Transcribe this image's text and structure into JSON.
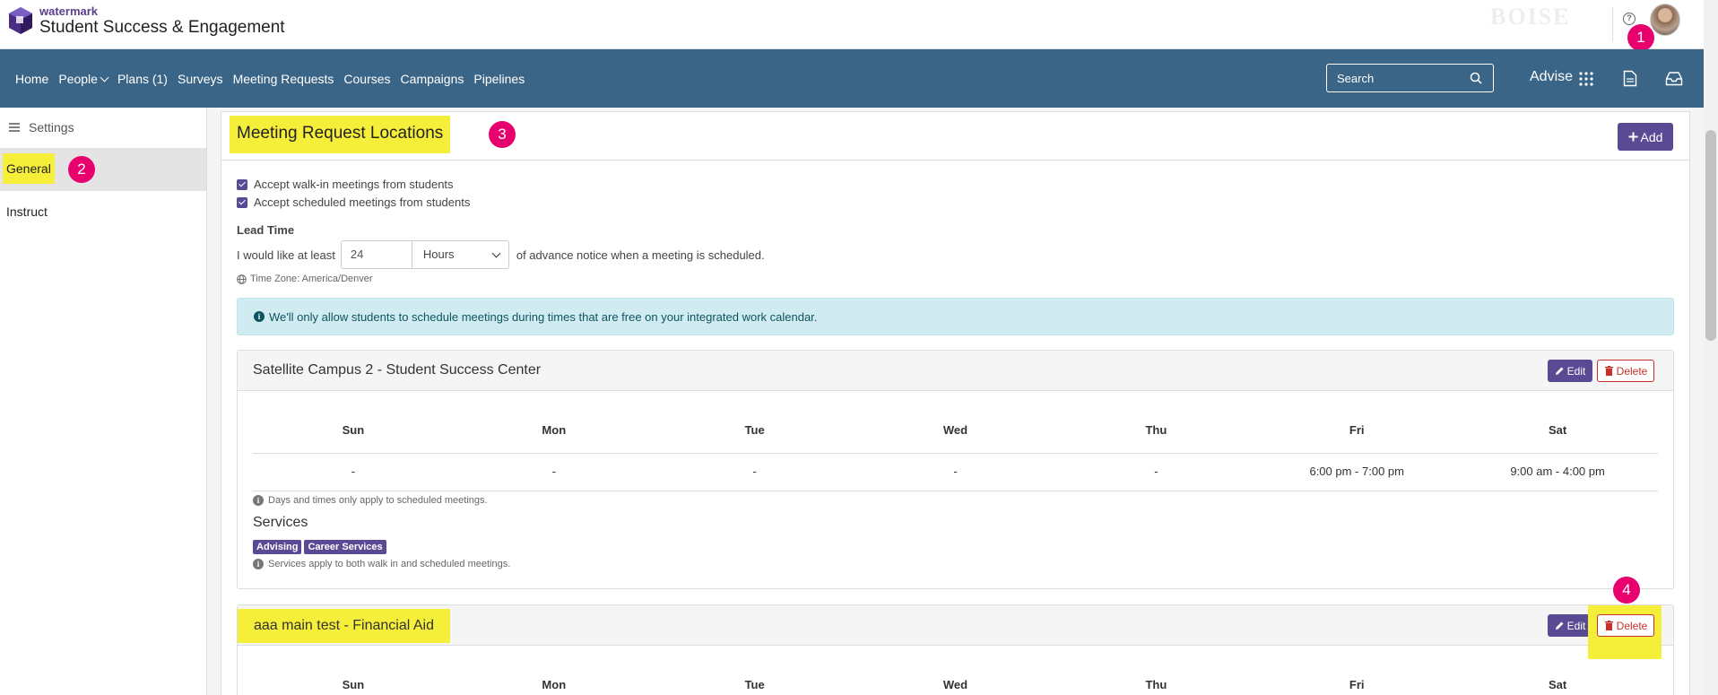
{
  "app": {
    "logo_small": "watermark",
    "logo_title": "Student Success & Engagement",
    "seal_text": "BOISE"
  },
  "callouts": [
    "1",
    "2",
    "3",
    "4"
  ],
  "nav": {
    "items": [
      "Home",
      "People",
      "Plans (1)",
      "Surveys",
      "Meeting Requests",
      "Courses",
      "Campaigns",
      "Pipelines"
    ],
    "search_placeholder": "Search",
    "advise_label": "Advise"
  },
  "sidebar": {
    "header": "Settings",
    "items": [
      "General",
      "Instruct"
    ]
  },
  "page": {
    "title": "Meeting Request Locations",
    "add_label": "Add",
    "check_walkin": "Accept walk-in meetings from students",
    "check_scheduled": "Accept scheduled meetings from students",
    "lead_time_label": "Lead Time",
    "lead_prefix": "I would like at least",
    "lead_value": "24",
    "lead_unit": "Hours",
    "lead_suffix": "of advance notice when a meeting is scheduled.",
    "timezone": "Time Zone: America/Denver",
    "alert": "We'll only allow students to schedule meetings during times that are free on your integrated work calendar."
  },
  "days": [
    "Sun",
    "Mon",
    "Tue",
    "Wed",
    "Thu",
    "Fri",
    "Sat"
  ],
  "locations": [
    {
      "name": "Satellite Campus 2 - Student Success Center",
      "edit_label": "Edit",
      "delete_label": "Delete",
      "hours": [
        "-",
        "-",
        "-",
        "-",
        "-",
        "6:00 pm - 7:00 pm",
        "9:00 am - 4:00 pm"
      ],
      "days_note": "Days and times only apply to scheduled meetings.",
      "services_title": "Services",
      "services": [
        "Advising",
        "Career Services"
      ],
      "services_note": "Services apply to both walk in and scheduled meetings."
    },
    {
      "name": "aaa main test - Financial Aid",
      "edit_label": "Edit",
      "delete_label": "Delete"
    }
  ],
  "colors": {
    "nav_bg": "#3a6587",
    "primary": "#5a4a94",
    "highlight": "#f5ef3a",
    "callout": "#e8006f",
    "danger": "#c9302c",
    "alert_bg": "#d1ecf1"
  }
}
